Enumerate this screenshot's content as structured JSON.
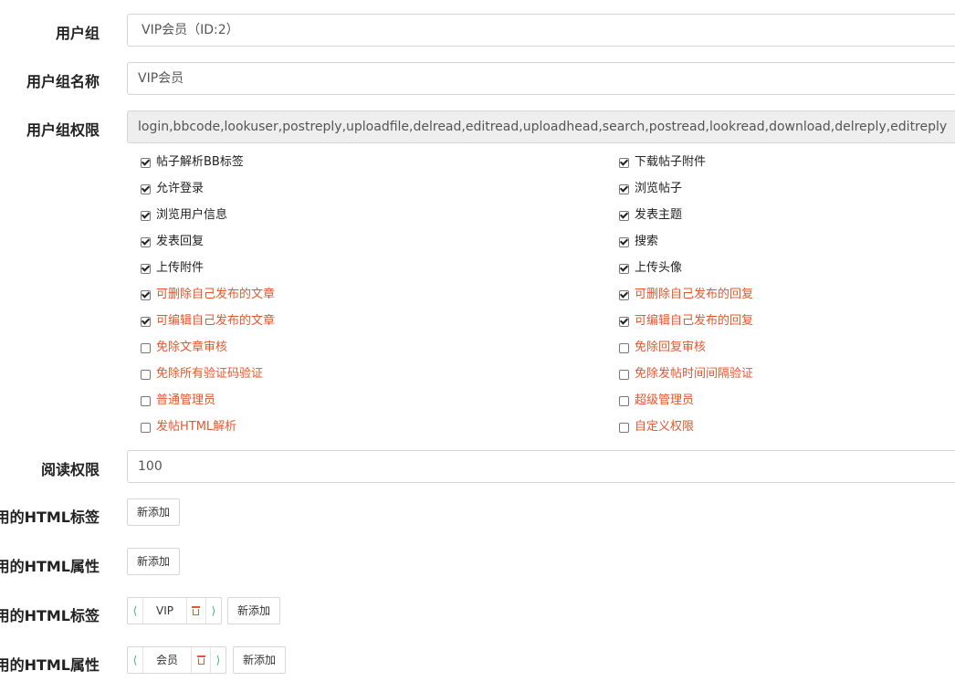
{
  "form": {
    "group": {
      "label": "用户组",
      "value": "VIP会员（ID:2）"
    },
    "group_name": {
      "label": "用户组名称",
      "value": "VIP会员"
    },
    "permissions": {
      "label": "用户组权限",
      "value": "login,bbcode,lookuser,postreply,uploadfile,delread,editread,uploadhead,search,postread,lookread,download,delreply,editreply",
      "options": [
        {
          "label": "帖子解析BB标签",
          "checked": true,
          "color": "normal"
        },
        {
          "label": "下载帖子附件",
          "checked": true,
          "color": "normal"
        },
        {
          "label": "允许登录",
          "checked": true,
          "color": "normal"
        },
        {
          "label": "浏览帖子",
          "checked": true,
          "color": "normal"
        },
        {
          "label": "浏览用户信息",
          "checked": true,
          "color": "normal"
        },
        {
          "label": "发表主题",
          "checked": true,
          "color": "normal"
        },
        {
          "label": "发表回复",
          "checked": true,
          "color": "normal"
        },
        {
          "label": "搜索",
          "checked": true,
          "color": "normal"
        },
        {
          "label": "上传附件",
          "checked": true,
          "color": "normal"
        },
        {
          "label": "上传头像",
          "checked": true,
          "color": "normal"
        },
        {
          "label": "可删除自己发布的文章",
          "checked": true,
          "color": "red"
        },
        {
          "label": "可删除自己发布的回复",
          "checked": true,
          "color": "red"
        },
        {
          "label": "可编辑自己发布的文章",
          "checked": true,
          "color": "red"
        },
        {
          "label": "可编辑自己发布的回复",
          "checked": true,
          "color": "red"
        },
        {
          "label": "免除文章审核",
          "checked": false,
          "color": "red"
        },
        {
          "label": "免除回复审核",
          "checked": false,
          "color": "red"
        },
        {
          "label": "免除所有验证码验证",
          "checked": false,
          "color": "red"
        },
        {
          "label": "免除发帖时间间隔验证",
          "checked": false,
          "color": "red"
        },
        {
          "label": "普通管理员",
          "checked": false,
          "color": "red"
        },
        {
          "label": "超级管理员",
          "checked": false,
          "color": "red"
        },
        {
          "label": "发帖HTML解析",
          "checked": false,
          "color": "red"
        },
        {
          "label": "自定义权限",
          "checked": false,
          "color": "red"
        }
      ]
    },
    "read_permission": {
      "label": "阅读权限",
      "value": "100"
    },
    "html_tags_1": {
      "label": "用的HTML标签",
      "add_label": "新添加"
    },
    "html_attrs_1": {
      "label": "用的HTML属性",
      "add_label": "新添加"
    },
    "html_tags_2": {
      "label": "用的HTML标签",
      "tag_value": "VIP",
      "add_label": "新添加"
    },
    "html_attrs_2": {
      "label": "用的HTML属性",
      "tag_value": "会员",
      "add_label": "新添加"
    }
  },
  "colors": {
    "warning_text": "#e4572e",
    "arrow_green": "#3cb371"
  }
}
